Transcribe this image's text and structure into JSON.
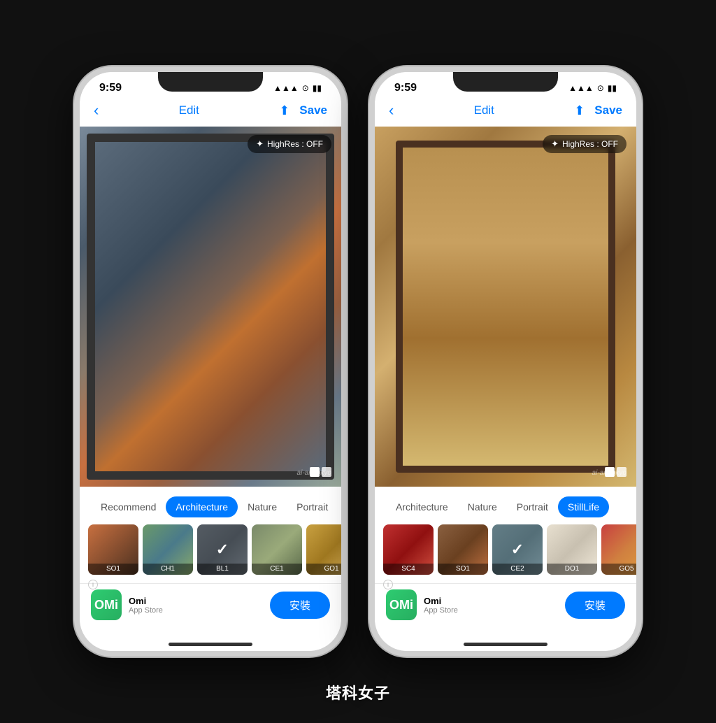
{
  "scene": {
    "background": "#111",
    "watermark": "塔科女子"
  },
  "phone_left": {
    "status": {
      "time": "9:59",
      "signal": "▲▲▲",
      "wifi": "WiFi",
      "battery": "Battery"
    },
    "nav": {
      "back": "‹",
      "title": "Edit",
      "save": "Save"
    },
    "highres": "HighRes : OFF",
    "painting_credit": "ai-art.tokyo",
    "tabs": [
      {
        "label": "Recommend",
        "active": false
      },
      {
        "label": "Architecture",
        "active": true
      },
      {
        "label": "Nature",
        "active": false
      },
      {
        "label": "Portrait",
        "active": false
      }
    ],
    "thumbnails": [
      {
        "id": "SO1",
        "label": "SO1",
        "selected": false,
        "color": "t-so1"
      },
      {
        "id": "CH1",
        "label": "CH1",
        "selected": false,
        "color": "t-ch1"
      },
      {
        "id": "BL1",
        "label": "BL1",
        "selected": true,
        "color": "t-bl1"
      },
      {
        "id": "CE1",
        "label": "CE1",
        "selected": false,
        "color": "t-ce1"
      },
      {
        "id": "GO1",
        "label": "GO1",
        "selected": false,
        "color": "t-go1"
      }
    ],
    "ad": {
      "app_name": "Omi",
      "store": "App Store",
      "install_label": "安裝",
      "logo_text": "OMi"
    }
  },
  "phone_right": {
    "status": {
      "time": "9:59"
    },
    "nav": {
      "back": "‹",
      "title": "Edit",
      "save": "Save"
    },
    "highres": "HighRes : OFF",
    "painting_credit": "ai-art.tokyo",
    "tabs": [
      {
        "label": "Architecture",
        "active": false
      },
      {
        "label": "Nature",
        "active": false
      },
      {
        "label": "Portrait",
        "active": false
      },
      {
        "label": "StillLife",
        "active": true
      }
    ],
    "thumbnails": [
      {
        "id": "SC4",
        "label": "SC4",
        "selected": false,
        "color": "t-sc4"
      },
      {
        "id": "SO1",
        "label": "SO1",
        "selected": false,
        "color": "t-so1r"
      },
      {
        "id": "CE2",
        "label": "CE2",
        "selected": true,
        "color": "t-ce2"
      },
      {
        "id": "DO1",
        "label": "DO1",
        "selected": false,
        "color": "t-do1"
      },
      {
        "id": "GO5",
        "label": "GO5",
        "selected": false,
        "color": "t-go5"
      },
      {
        "id": "extra",
        "label": "...",
        "selected": false,
        "color": "t-extra"
      }
    ],
    "ad": {
      "app_name": "Omi",
      "store": "App Store",
      "install_label": "安裝",
      "logo_text": "OMi"
    }
  }
}
